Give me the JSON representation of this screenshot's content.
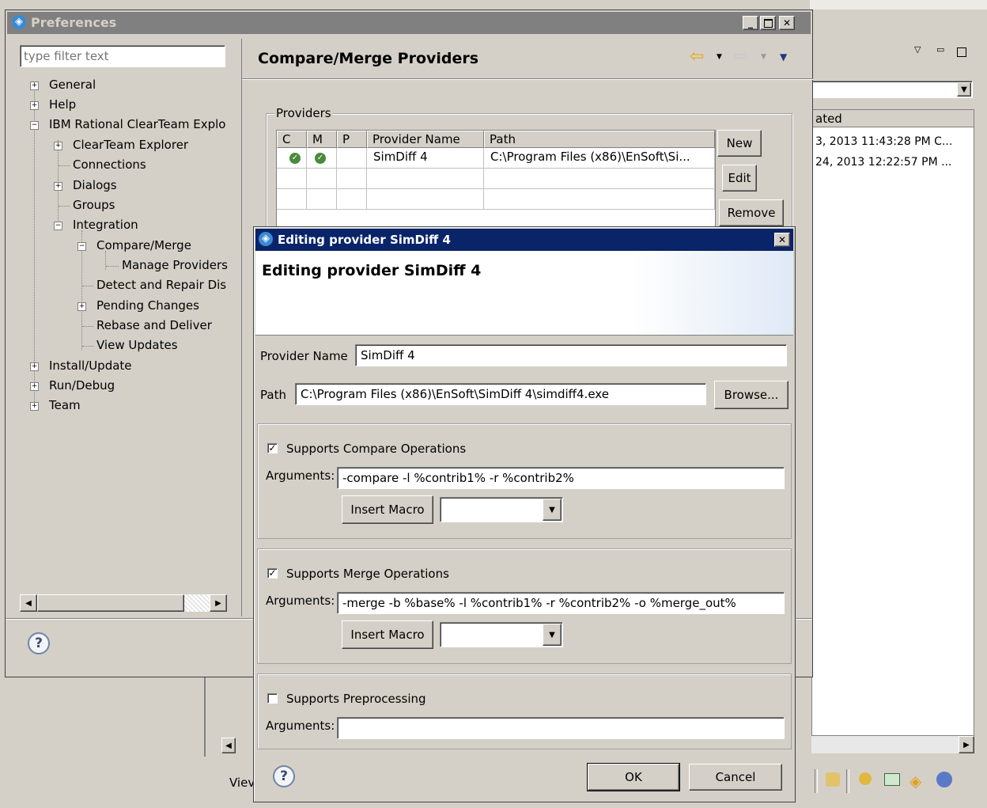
{
  "background_window": {
    "table_header": "ated",
    "rows": [
      "3, 2013 11:43:28 PM C...",
      "24, 2013 12:22:57 PM ..."
    ],
    "status_label": "Viev"
  },
  "preferences": {
    "title": "Preferences",
    "filter_placeholder": "type filter text",
    "page_title": "Compare/Merge Providers",
    "tree": {
      "general": "General",
      "help": "Help",
      "ibm": "IBM Rational ClearTeam Explo",
      "clearteam_explorer": "ClearTeam Explorer",
      "connections": "Connections",
      "dialogs": "Dialogs",
      "groups": "Groups",
      "integration": "Integration",
      "compare_merge": "Compare/Merge",
      "manage_providers": "Manage Providers",
      "detect_repair": "Detect and Repair Dis",
      "pending_changes": "Pending Changes",
      "rebase_deliver": "Rebase and Deliver",
      "view_updates": "View Updates",
      "install_update": "Install/Update",
      "run_debug": "Run/Debug",
      "team": "Team"
    },
    "providers": {
      "group_label": "Providers",
      "columns": {
        "c": "C",
        "m": "M",
        "p": "P",
        "name": "Provider Name",
        "path": "Path"
      },
      "rows": [
        {
          "name": "SimDiff 4",
          "path": "C:\\Program Files (x86)\\EnSoft\\Si..."
        }
      ],
      "new_label": "New",
      "edit_label": "Edit",
      "remove_label": "Remove"
    }
  },
  "editor": {
    "title": "Editing provider SimDiff 4",
    "header": "Editing provider SimDiff 4",
    "provider_name_label": "Provider Name",
    "provider_name_value": "SimDiff 4",
    "path_label": "Path",
    "path_value": "C:\\Program Files (x86)\\EnSoft\\SimDiff 4\\simdiff4.exe",
    "browse_label": "Browse...",
    "compare": {
      "label": "Supports Compare Operations",
      "checked": true,
      "arguments_label": "Arguments:",
      "arguments_value": "-compare -l %contrib1% -r %contrib2%",
      "insert_macro_label": "Insert Macro"
    },
    "merge": {
      "label": "Supports Merge Operations",
      "checked": true,
      "arguments_label": "Arguments:",
      "arguments_value": "-merge -b %base% -l %contrib1% -r %contrib2% -o %merge_out%",
      "insert_macro_label": "Insert Macro"
    },
    "preprocessing": {
      "label": "Supports Preprocessing",
      "checked": false,
      "arguments_label": "Arguments:",
      "arguments_value": ""
    },
    "ok_label": "OK",
    "cancel_label": "Cancel"
  },
  "colors": {
    "title_active": "#0a246a",
    "title_gradient_end": "#a6caf0",
    "title_inactive": "#808080",
    "check_green": "#4a8a3c"
  }
}
